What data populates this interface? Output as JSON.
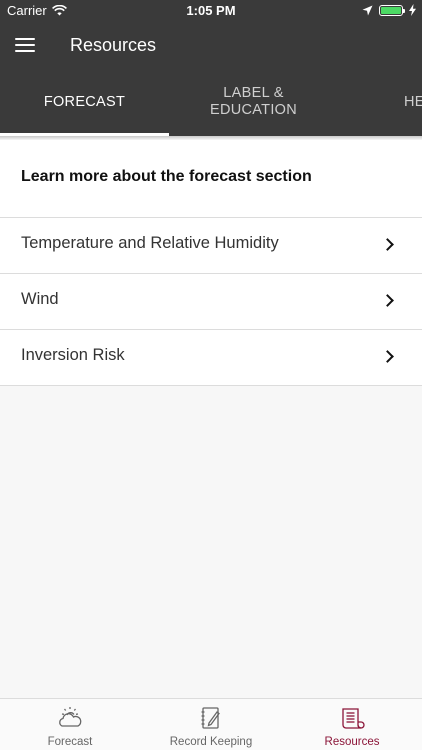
{
  "status_bar": {
    "carrier": "Carrier",
    "time": "1:05 PM"
  },
  "app_bar": {
    "title": "Resources"
  },
  "tabs": [
    {
      "label": "FORECAST",
      "active": true
    },
    {
      "label": "LABEL & EDUCATION",
      "active": false
    },
    {
      "label": "HE",
      "active": false
    }
  ],
  "section": {
    "header": "Learn more about the forecast section"
  },
  "items": [
    {
      "label": "Temperature and Relative Humidity"
    },
    {
      "label": "Wind"
    },
    {
      "label": "Inversion Risk"
    }
  ],
  "bottom_nav": [
    {
      "label": "Forecast",
      "icon": "cloud-sun-icon",
      "active": false
    },
    {
      "label": "Record Keeping",
      "icon": "notebook-pencil-icon",
      "active": false
    },
    {
      "label": "Resources",
      "icon": "document-icon",
      "active": true
    }
  ],
  "colors": {
    "header_bg": "#3a3a3a",
    "accent": "#8b1538",
    "battery": "#4cd964"
  }
}
